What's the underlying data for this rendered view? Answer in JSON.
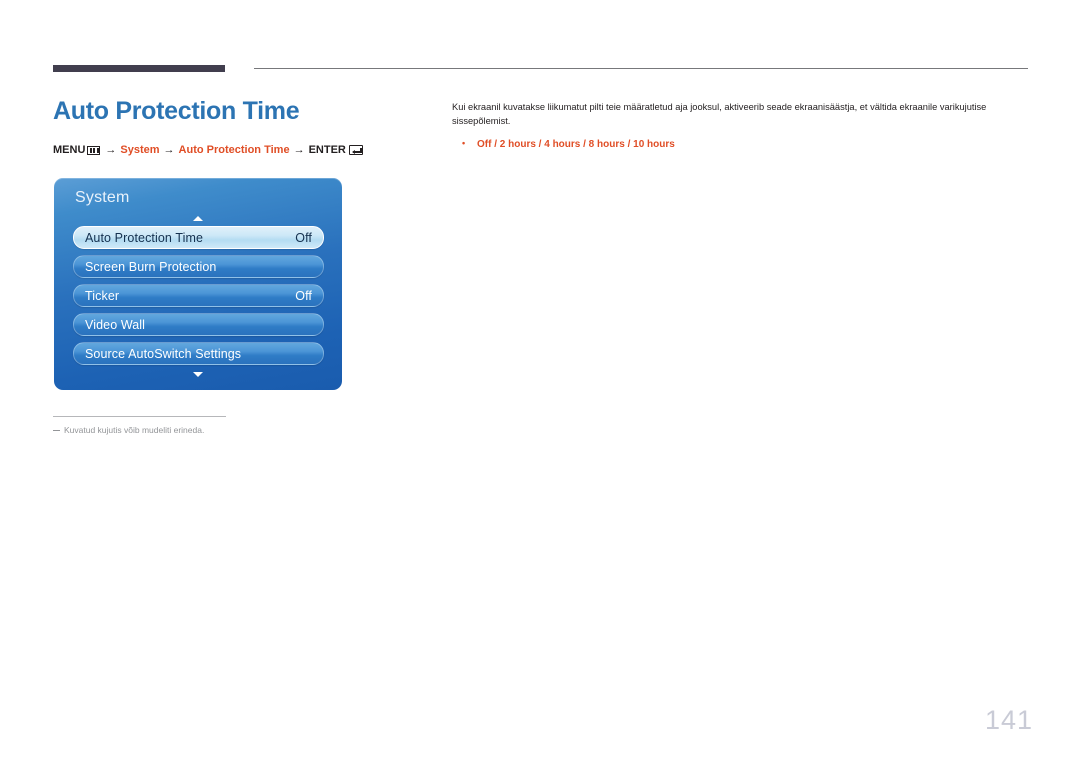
{
  "header": {
    "thick_rule_color": "#413e4e",
    "thin_rule_color": "#77787b"
  },
  "page": {
    "title": "Auto Protection Time",
    "title_color": "#2c74b3",
    "number": "141"
  },
  "breadcrumb": {
    "menu_label": "MENU",
    "menu_icon": "menu-grid-icon",
    "arrow": "→",
    "items": [
      {
        "label": "System",
        "color": "#e04e26"
      },
      {
        "label": "Auto Protection Time",
        "color": "#e04e26"
      }
    ],
    "enter_label": "ENTER",
    "enter_icon": "enter-return-icon"
  },
  "osd": {
    "title": "System",
    "scroll_up_icon": "triangle-up-icon",
    "scroll_down_icon": "triangle-down-icon",
    "rows": [
      {
        "label": "Auto Protection Time",
        "value": "Off",
        "selected": true
      },
      {
        "label": "Screen Burn Protection",
        "value": "",
        "selected": false
      },
      {
        "label": "Ticker",
        "value": "Off",
        "selected": false
      },
      {
        "label": "Video Wall",
        "value": "",
        "selected": false
      },
      {
        "label": "Source AutoSwitch Settings",
        "value": "",
        "selected": false
      }
    ]
  },
  "footnote": {
    "text": "Kuvatud kujutis võib mudeliti erineda."
  },
  "content": {
    "paragraph": "Kui ekraanil kuvatakse liikumatut pilti teie määratletud aja jooksul, aktiveerib seade ekraanisäästja, et vältida ekraanile varikujutise sissepõlemist.",
    "options_line": "Off / 2 hours / 4 hours / 8 hours / 10 hours"
  }
}
